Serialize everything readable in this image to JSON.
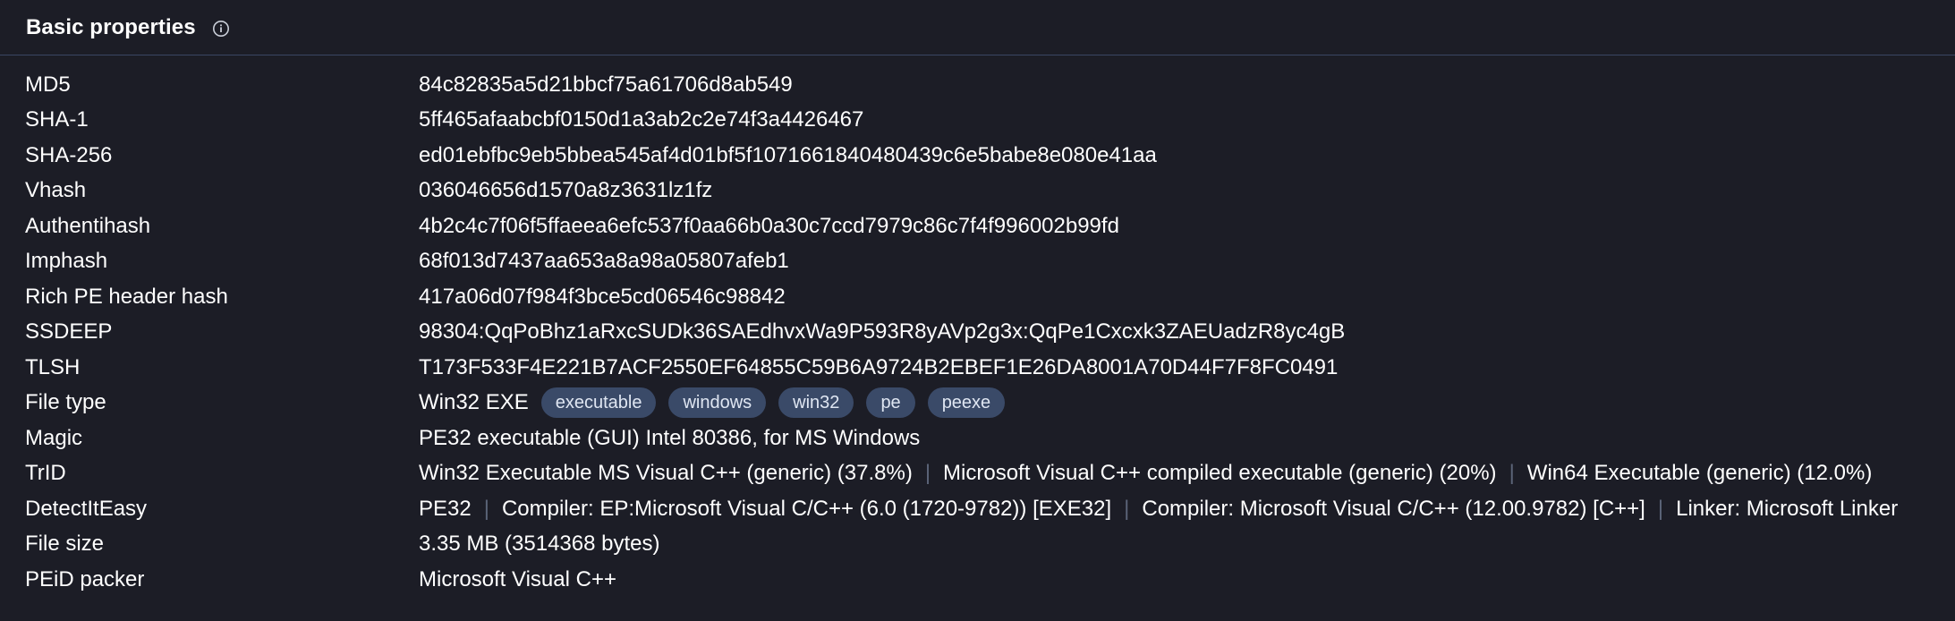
{
  "section": {
    "title": "Basic properties"
  },
  "properties": {
    "md5": {
      "label": "MD5",
      "value": "84c82835a5d21bbcf75a61706d8ab549"
    },
    "sha1": {
      "label": "SHA-1",
      "value": "5ff465afaabcbf0150d1a3ab2c2e74f3a4426467"
    },
    "sha256": {
      "label": "SHA-256",
      "value": "ed01ebfbc9eb5bbea545af4d01bf5f1071661840480439c6e5babe8e080e41aa"
    },
    "vhash": {
      "label": "Vhash",
      "value": "036046656d1570a8z3631lz1fz"
    },
    "authentihash": {
      "label": "Authentihash",
      "value": "4b2c4c7f06f5ffaeea6efc537f0aa66b0a30c7ccd7979c86c7f4f996002b99fd"
    },
    "imphash": {
      "label": "Imphash",
      "value": "68f013d7437aa653a8a98a05807afeb1"
    },
    "richpe": {
      "label": "Rich PE header hash",
      "value": "417a06d07f984f3bce5cd06546c98842"
    },
    "ssdeep": {
      "label": "SSDEEP",
      "value": "98304:QqPoBhz1aRxcSUDk36SAEdhvxWa9P593R8yAVp2g3x:QqPe1Cxcxk3ZAEUadzR8yc4gB"
    },
    "tlsh": {
      "label": "TLSH",
      "value": "T173F533F4E221B7ACF2550EF64855C59B6A9724B2EBEF1E26DA8001A70D44F7F8FC0491"
    },
    "filetype": {
      "label": "File type",
      "value": "Win32 EXE",
      "tags": [
        "executable",
        "windows",
        "win32",
        "pe",
        "peexe"
      ]
    },
    "magic": {
      "label": "Magic",
      "value": "PE32 executable (GUI) Intel 80386, for MS Windows"
    },
    "trid": {
      "label": "TrID",
      "segments": [
        "Win32 Executable MS Visual C++ (generic) (37.8%)",
        "Microsoft Visual C++ compiled executable (generic) (20%)",
        "Win64 Executable (generic) (12.0%)"
      ]
    },
    "detectiteasy": {
      "label": "DetectItEasy",
      "segments": [
        "PE32",
        "Compiler: EP:Microsoft Visual C/C++ (6.0 (1720-9782)) [EXE32]",
        "Compiler: Microsoft Visual C/C++ (12.00.9782) [C++]",
        "Linker: Microsoft Linker"
      ]
    },
    "filesize": {
      "label": "File size",
      "value": "3.35 MB (3514368 bytes)"
    },
    "peid": {
      "label": "PEiD packer",
      "value": "Microsoft Visual C++"
    }
  },
  "colors": {
    "background": "#1c1d26",
    "divider": "#3a4663",
    "tag_background": "#3a4a68",
    "separator": "#5b6478"
  },
  "icons": {
    "info": "info-circle-icon"
  }
}
